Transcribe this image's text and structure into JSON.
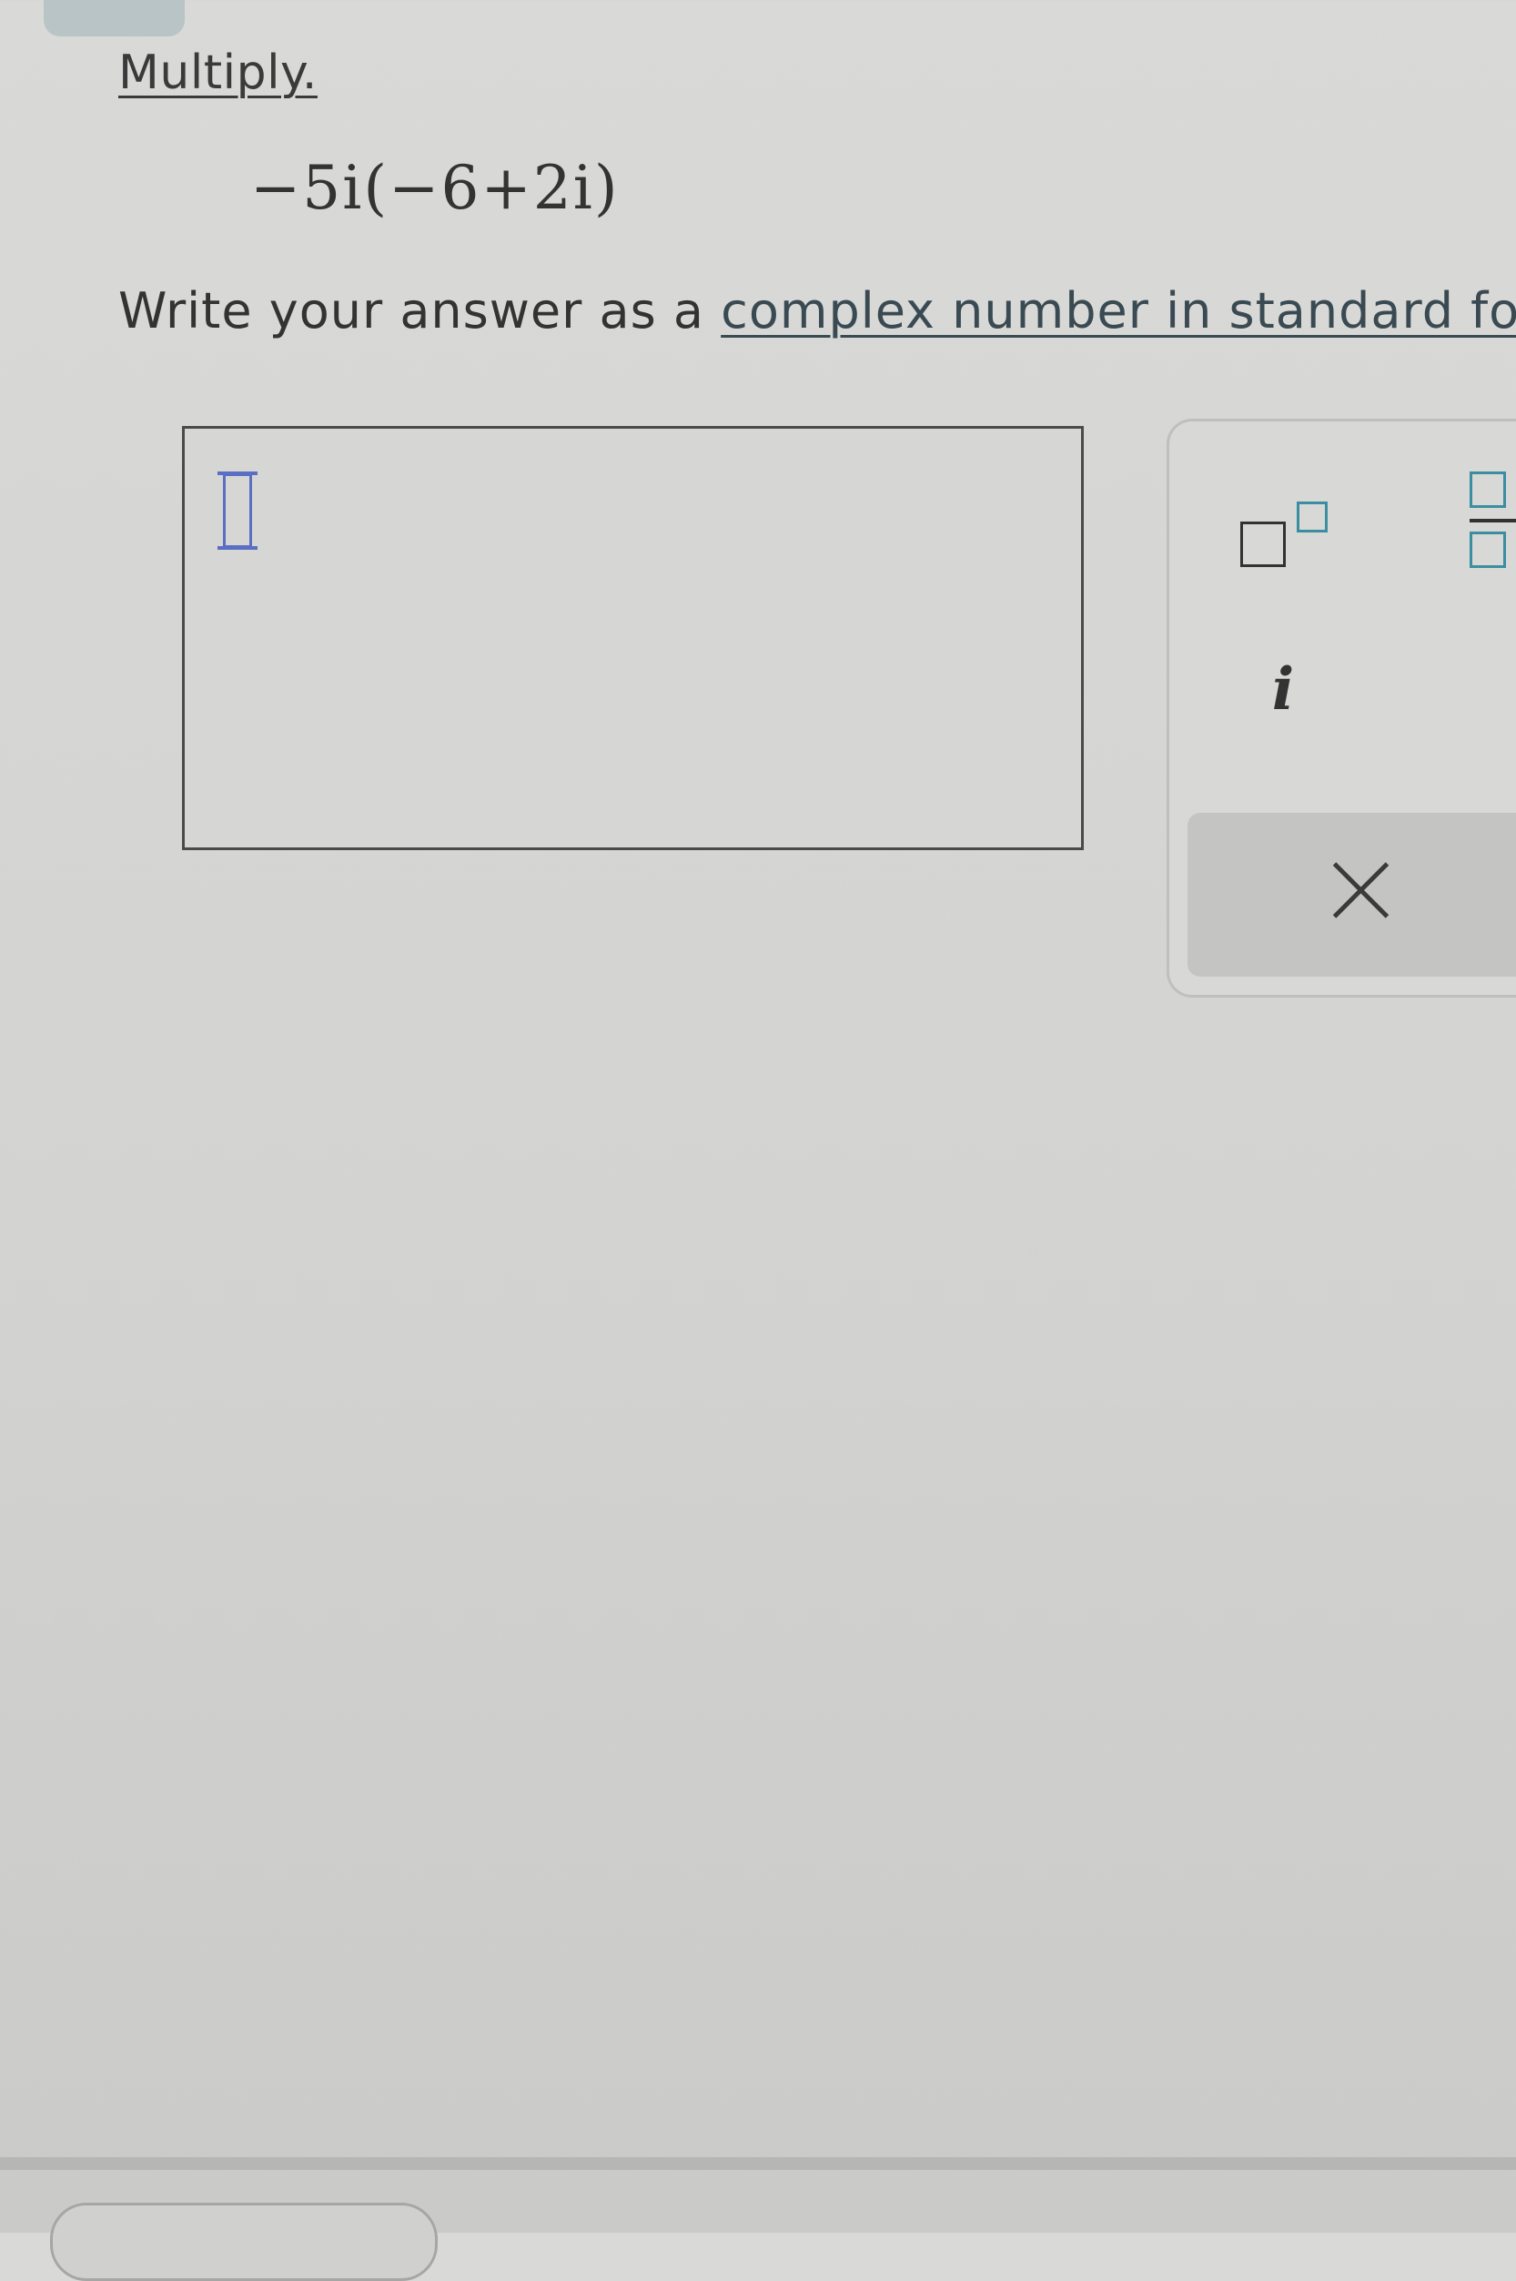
{
  "problem": {
    "title": "Multiply.",
    "expression": "−5i(−6+2i)",
    "instruction_prefix": "Write your answer as a ",
    "instruction_link": "complex number in standard fo"
  },
  "answer": {
    "value": ""
  },
  "keypad": {
    "keys": {
      "superscript": "superscript-template",
      "fraction": "fraction-template",
      "imaginary": "i",
      "clear": "×"
    }
  },
  "colors": {
    "background": "#d6d6d4",
    "accent": "#3b8ea0",
    "cursor": "#5a6fc4",
    "text": "#333333"
  }
}
